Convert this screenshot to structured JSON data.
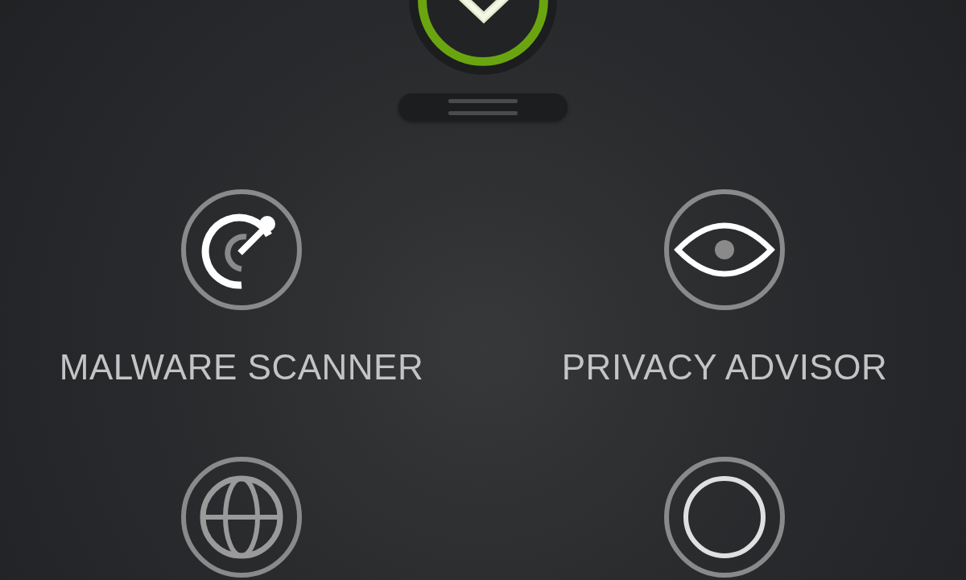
{
  "features": [
    {
      "label": "MALWARE SCANNER"
    },
    {
      "label": "PRIVACY ADVISOR"
    }
  ]
}
